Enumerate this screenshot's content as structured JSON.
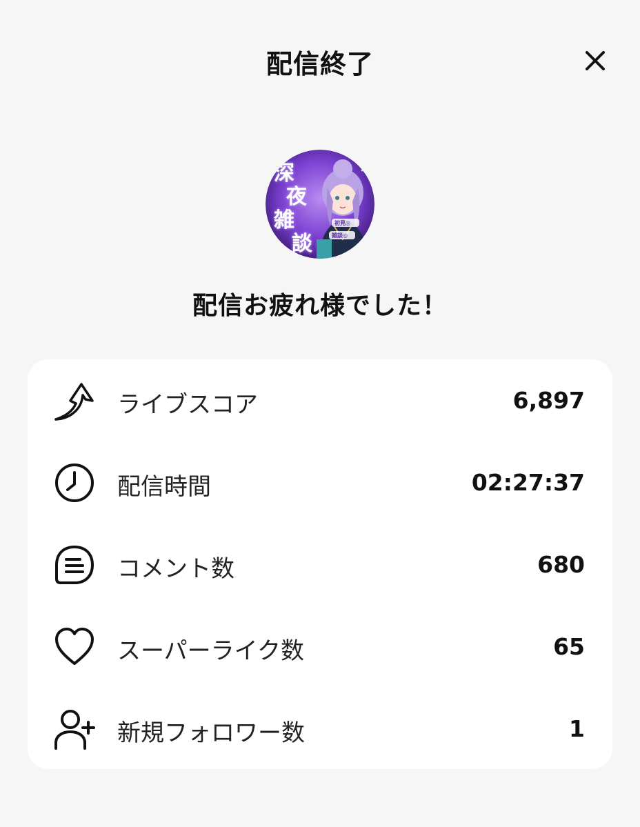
{
  "header": {
    "title": "配信終了"
  },
  "message": "配信お疲れ様でした！",
  "avatar": {
    "text_chars": [
      "深",
      "夜",
      "雑",
      "談"
    ],
    "badge_text": [
      "初見◎",
      "雑談◎"
    ]
  },
  "stats": [
    {
      "label": "ライブスコア",
      "value": "6,897",
      "icon": "score-arrow-icon"
    },
    {
      "label": "配信時間",
      "value": "02:27:37",
      "icon": "clock-icon"
    },
    {
      "label": "コメント数",
      "value": "680",
      "icon": "comment-icon"
    },
    {
      "label": "スーパーライク数",
      "value": "65",
      "icon": "heart-icon"
    },
    {
      "label": "新規フォロワー数",
      "value": "1",
      "icon": "add-user-icon"
    }
  ]
}
